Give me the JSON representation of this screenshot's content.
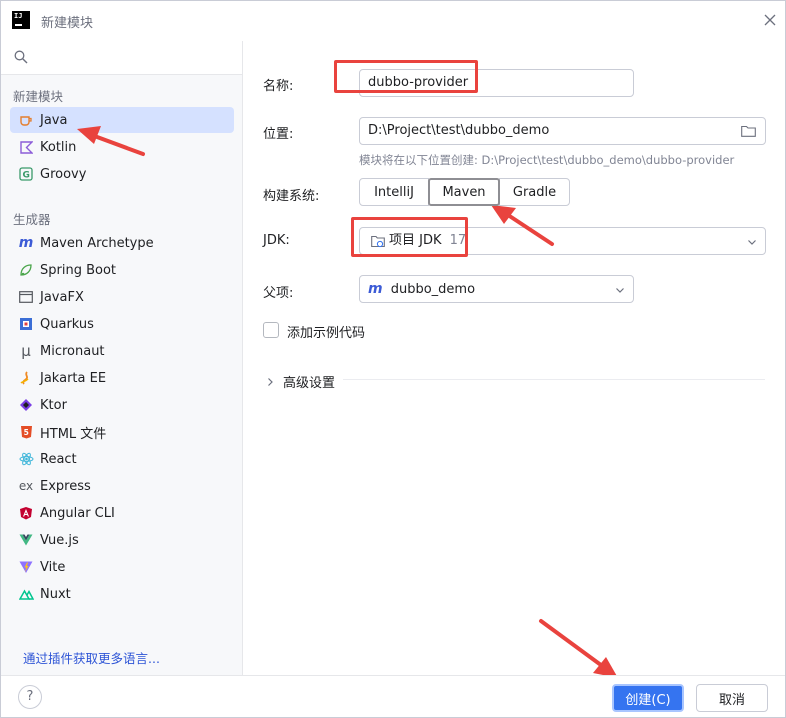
{
  "window": {
    "title": "新建模块"
  },
  "sidebar": {
    "search_placeholder": "",
    "section_new": "新建模块",
    "new_items": [
      {
        "label": "Java",
        "icon": "java-cup-icon"
      },
      {
        "label": "Kotlin",
        "icon": "kotlin-icon"
      },
      {
        "label": "Groovy",
        "icon": "groovy-icon"
      }
    ],
    "section_generators": "生成器",
    "generator_items": [
      {
        "label": "Maven Archetype",
        "icon": "maven-icon"
      },
      {
        "label": "Spring Boot",
        "icon": "spring-icon"
      },
      {
        "label": "JavaFX",
        "icon": "window-icon"
      },
      {
        "label": "Quarkus",
        "icon": "quarkus-icon"
      },
      {
        "label": "Micronaut",
        "icon": "micronaut-icon"
      },
      {
        "label": "Jakarta EE",
        "icon": "jakarta-icon"
      },
      {
        "label": "Ktor",
        "icon": "ktor-icon"
      },
      {
        "label": "HTML 文件",
        "icon": "html5-icon"
      },
      {
        "label": "React",
        "icon": "react-icon"
      },
      {
        "label": "Express",
        "icon": "express-icon"
      },
      {
        "label": "Angular CLI",
        "icon": "angular-icon"
      },
      {
        "label": "Vue.js",
        "icon": "vue-icon"
      },
      {
        "label": "Vite",
        "icon": "vite-icon"
      },
      {
        "label": "Nuxt",
        "icon": "nuxt-icon"
      }
    ],
    "plugin_link": "通过插件获取更多语言..."
  },
  "form": {
    "name_label": "名称:",
    "name_value": "dubbo-provider",
    "location_label": "位置:",
    "location_value": "D:\\Project\\test\\dubbo_demo",
    "location_hint": "模块将在以下位置创建: D:\\Project\\test\\dubbo_demo\\dubbo-provider",
    "build_label": "构建系统:",
    "build_options": [
      "IntelliJ",
      "Maven",
      "Gradle"
    ],
    "build_selected": "Maven",
    "jdk_label": "JDK:",
    "jdk_value": "项目 JDK",
    "jdk_version": "17",
    "parent_label": "父项:",
    "parent_value": "dubbo_demo",
    "sample_code_label": "添加示例代码",
    "sample_code_checked": false,
    "advanced_label": "高级设置"
  },
  "footer": {
    "help": "?",
    "create_button": "创建(C)",
    "cancel_button": "取消"
  },
  "colors": {
    "accent": "#3574f0",
    "selection": "#d5e1ff",
    "annotation": "#e9433e"
  }
}
